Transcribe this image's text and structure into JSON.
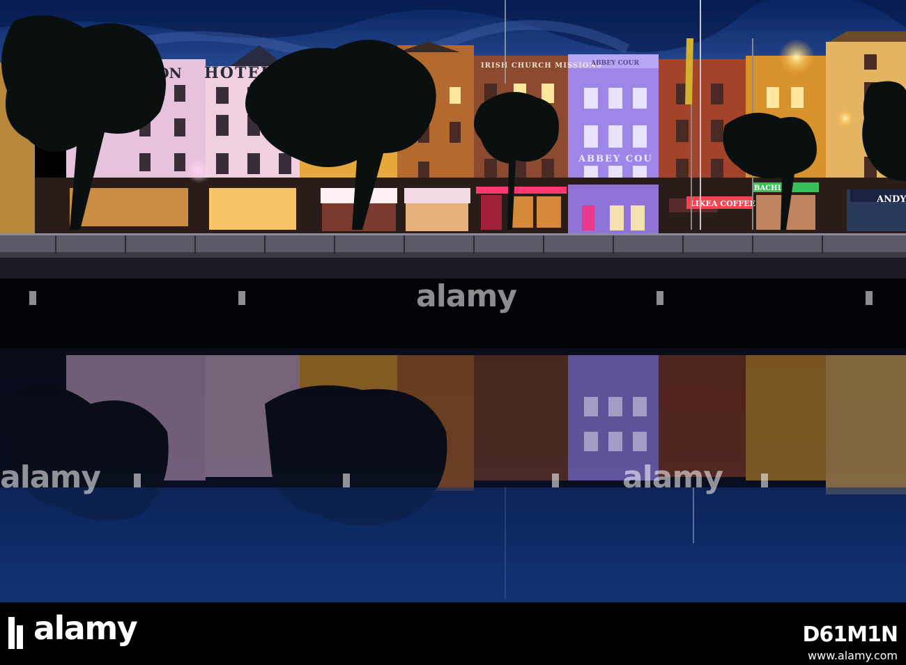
{
  "scene": {
    "description_tag": "night riverfront",
    "colors": {
      "sky_top": "#0a2a6e",
      "sky_bottom": "#2a4e9a",
      "water_top": "#04060e",
      "water_bottom": "#0d2a66"
    },
    "signs": {
      "hotel": "HOTEL",
      "hotel_prefix": "NGTON",
      "church": "IRISH CHURCH MISSIONS",
      "abbey_top": "ABBEY COUR",
      "abbey_mid": "ABBEY COU",
      "coffee": "LIKEA COFFEE",
      "andy": "ANDY",
      "bachelor": "BACHLO"
    }
  },
  "watermark": {
    "text": "alamy"
  },
  "footer": {
    "logo": "alamy",
    "image_id": "D61M1N",
    "url": "www.alamy.com"
  }
}
